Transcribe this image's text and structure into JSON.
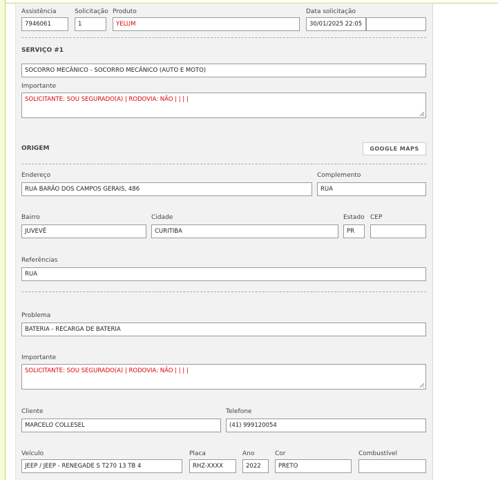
{
  "header": {
    "assistencia_label": "Assistência",
    "assistencia": "7946061",
    "solicitacao_label": "Solicitação",
    "solicitacao": "1",
    "produto_label": "Produto",
    "produto": "YELUM",
    "data_label": "Data solicitação",
    "data": "30/01/2025 22:05",
    "data_extra": ""
  },
  "servico": {
    "title": "SERVIÇO #1",
    "value": "SOCORRO MECÂNICO - SOCORRO MECÂNICO (AUTO E MOTO)",
    "importante_label": "Importante",
    "importante": "SOLICITANTE: SOU SEGURADO(A) | RODOVIA: NÃO |  |  |  |"
  },
  "origem": {
    "title": "ORIGEM",
    "maps_button": "GOOGLE MAPS",
    "endereco_label": "Endereço",
    "endereco": "RUA BARÃO DOS CAMPOS GERAIS, 486",
    "complemento_label": "Complemento",
    "complemento": "RUA",
    "bairro_label": "Bairro",
    "bairro": "JUVEVÊ",
    "cidade_label": "Cidade",
    "cidade": "CURITIBA",
    "estado_label": "Estado",
    "estado": "PR",
    "cep_label": "CEP",
    "cep": "",
    "referencias_label": "Referências",
    "referencias": "RUA"
  },
  "problema": {
    "label": "Problema",
    "value": "BATERIA - RECARGA DE BATERIA",
    "importante_label": "Importante",
    "importante": "SOLICITANTE: SOU SEGURADO(A) | RODOVIA: NÃO |  |  |  |"
  },
  "cliente": {
    "cliente_label": "Cliente",
    "cliente": "MARCELO COLLESEL",
    "telefone_label": "Telefone",
    "telefone": "(41) 999120054"
  },
  "veiculo": {
    "veiculo_label": "Veículo",
    "veiculo": "JEEP / JEEP - RENEGADE S T270 13 TB 4",
    "placa_label": "Placa",
    "placa": "RHZ-XXXX",
    "ano_label": "Ano",
    "ano": "2022",
    "cor_label": "Cor",
    "cor": "PRETO",
    "combustivel_label": "Combustível",
    "combustivel": ""
  }
}
